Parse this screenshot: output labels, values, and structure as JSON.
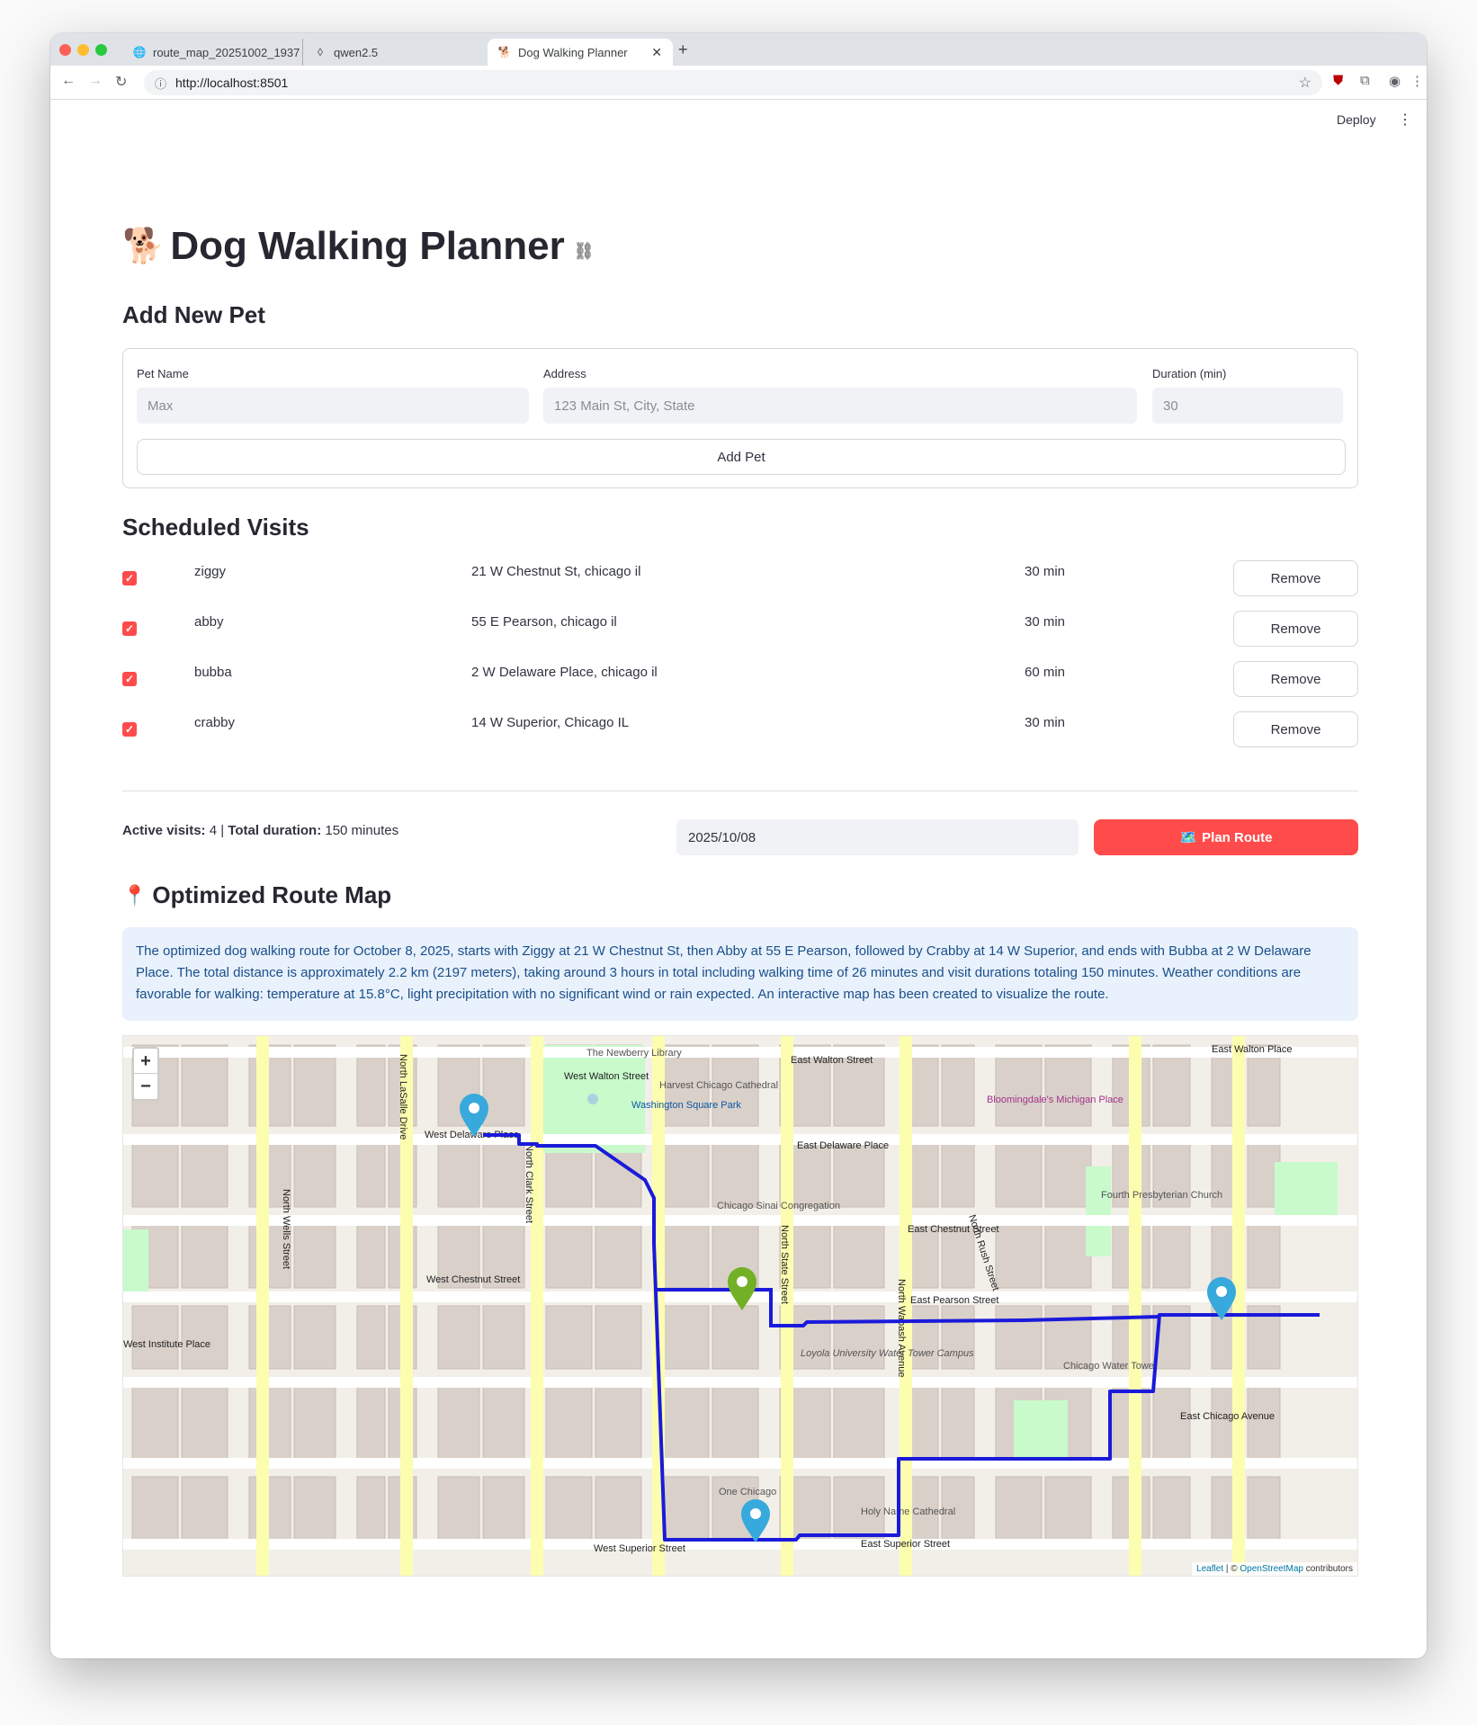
{
  "browser": {
    "tabs": [
      {
        "label": "route_map_20251002_1937",
        "icon": "globe-icon"
      },
      {
        "label": "qwen2.5",
        "icon": "llama-icon"
      },
      {
        "label": "Dog Walking Planner",
        "icon": "dog-icon",
        "active": true
      }
    ],
    "url": "http://localhost:8501"
  },
  "app_header": {
    "deploy_label": "Deploy"
  },
  "page": {
    "title": "Dog Walking Planner",
    "title_emoji": "🐕"
  },
  "add_pet": {
    "heading": "Add New Pet",
    "name_label": "Pet Name",
    "name_placeholder": "Max",
    "address_label": "Address",
    "address_placeholder": "123 Main St, City, State",
    "duration_label": "Duration (min)",
    "duration_placeholder": "30",
    "submit_label": "Add Pet"
  },
  "visits": {
    "heading": "Scheduled Visits",
    "remove_label": "Remove",
    "items": [
      {
        "name": "ziggy",
        "address": "21 W Chestnut St, chicago il",
        "duration": "30 min",
        "checked": true
      },
      {
        "name": "abby",
        "address": "55 E Pearson, chicago il",
        "duration": "30 min",
        "checked": true
      },
      {
        "name": "bubba",
        "address": "2 W Delaware Place, chicago il",
        "duration": "60 min",
        "checked": true
      },
      {
        "name": "crabby",
        "address": "14 W Superior, Chicago IL",
        "duration": "30 min",
        "checked": true
      }
    ]
  },
  "summary": {
    "active_label": "Active visits:",
    "active_value": "4",
    "sep": "|",
    "total_label": "Total duration:",
    "total_value": "150 minutes",
    "date": "2025/10/08",
    "plan_label": "Plan Route",
    "plan_icon": "🗺️"
  },
  "route_map": {
    "heading": "Optimized Route Map",
    "heading_icon": "📍",
    "description": "The optimized dog walking route for October 8, 2025, starts with Ziggy at 21 W Chestnut St, then Abby at 55 E Pearson, followed by Crabby at 14 W Superior, and ends with Bubba at 2 W Delaware Place. The total distance is approximately 2.2 km (2197 meters), taking around 3 hours in total including walking time of 26 minutes and visit durations totaling 150 minutes. Weather conditions are favorable for walking: temperature at 15.8°C, light precipitation with no significant wind or rain expected. An interactive map has been created to visualize the route.",
    "zoom_in": "+",
    "zoom_out": "−",
    "attribution_leaflet": "Leaflet",
    "attribution_sep": "| ©",
    "attribution_osm": "OpenStreetMap",
    "attribution_suffix": "contributors",
    "streets": [
      "West Walton Street",
      "East Walton Street",
      "East Walton Place",
      "West Delaware Place",
      "East Delaware Place",
      "West Chestnut Street",
      "East Chestnut Street",
      "East Pearson Street",
      "East Chicago Avenue",
      "West Superior Street",
      "East Superior Street",
      "North Clark Street",
      "North State Street",
      "North Wabash Avenue",
      "North Rush Street",
      "North LaSalle Drive",
      "North Wells Street",
      "West Institute Place"
    ],
    "places": [
      "The Newberry Library",
      "Washington Square Park",
      "Harvest Chicago Cathedral",
      "Chicago Sinai Congregation",
      "Loyola University Water Tower Campus",
      "Chicago Water Tower",
      "Fourth Presbyterian Church",
      "Holy Name Cathedral",
      "One Chicago",
      "Bloomingdale's Michigan Place"
    ]
  },
  "colors": {
    "accent": "#ff4b4b",
    "route": "#1a1adb",
    "info_bg": "#e8f1fc",
    "info_text": "#1b4f8a",
    "marker_blue": "#38a9dc",
    "marker_green": "#72b026"
  }
}
